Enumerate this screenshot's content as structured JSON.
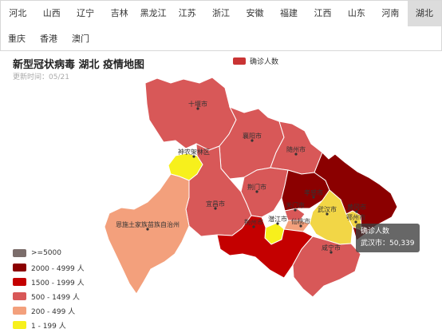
{
  "tabs_row1": [
    "河北",
    "山西",
    "辽宁",
    "吉林",
    "黑龙江",
    "江苏",
    "浙江",
    "安徽",
    "福建",
    "江西",
    "山东",
    "河南",
    "湖北"
  ],
  "tabs_row2": [
    "重庆",
    "香港",
    "澳门"
  ],
  "active_tab": "湖北",
  "title": "新型冠状病毒 湖北 疫情地图",
  "updated": "更新时间：05/21",
  "series_legend": {
    "label": "确诊人数",
    "color": "#c93434"
  },
  "legend": [
    {
      "label": ">=5000",
      "color": "#7b6d6b"
    },
    {
      "label": "2000 - 4999 人",
      "color": "#8b0000"
    },
    {
      "label": "1500 - 1999 人",
      "color": "#c40000"
    },
    {
      "label": "500 - 1499 人",
      "color": "#d85858"
    },
    {
      "label": "200 - 499 人",
      "color": "#f3a07c"
    },
    {
      "label": "1 - 199 人",
      "color": "#f7f01c"
    }
  ],
  "regions": [
    {
      "name": "十堰市",
      "color": "#d85858"
    },
    {
      "name": "襄阳市",
      "color": "#d85858"
    },
    {
      "name": "随州市",
      "color": "#d85858"
    },
    {
      "name": "神农架林区",
      "color": "#f7f01c"
    },
    {
      "name": "荆门市",
      "color": "#d85858"
    },
    {
      "name": "孝感市",
      "color": "#8b0000"
    },
    {
      "name": "黄冈市",
      "color": "#8b0000"
    },
    {
      "name": "武汉市",
      "color": "#f2d646"
    },
    {
      "name": "鄂州市",
      "color": "#f2d646"
    },
    {
      "name": "宜昌市",
      "color": "#d85858"
    },
    {
      "name": "恩施土家族苗族自治州",
      "color": "#f3a07c"
    },
    {
      "name": "天门市",
      "color": "#d85858"
    },
    {
      "name": "潜江市",
      "color": "#f7f01c"
    },
    {
      "name": "仙桃市",
      "color": "#f3a07c"
    },
    {
      "name": "荆州市",
      "color": "#c40000"
    },
    {
      "name": "咸宁市",
      "color": "#d85858"
    }
  ],
  "tooltip": {
    "title": "确诊人数",
    "text": "武汉市：50,339"
  }
}
